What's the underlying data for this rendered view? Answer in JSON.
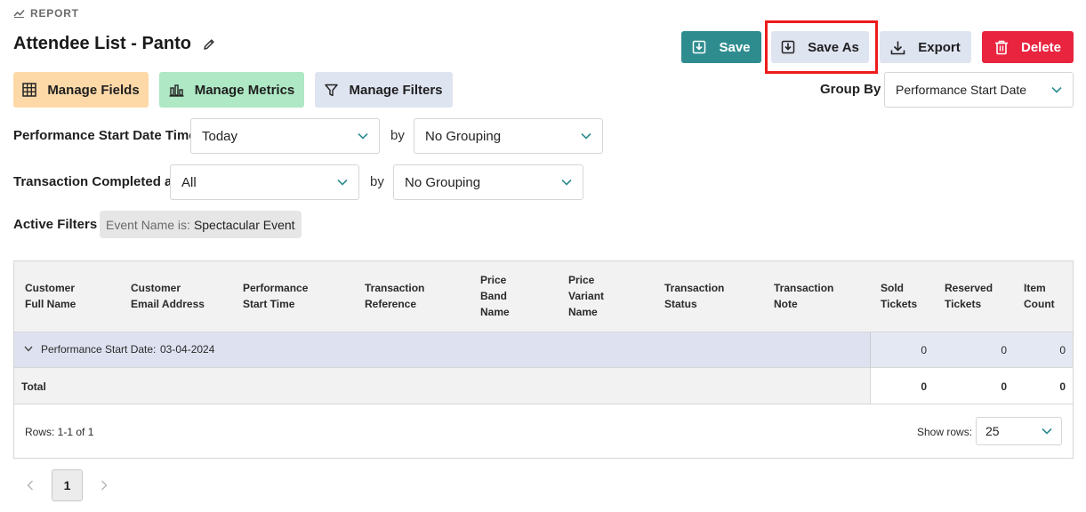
{
  "header": {
    "section_label": "REPORT",
    "title": "Attendee List - Panto",
    "icons": {
      "section": "trend-line-icon",
      "edit": "pencil-icon"
    }
  },
  "actions": {
    "save": "Save",
    "save_as": "Save As",
    "export": "Export",
    "delete": "Delete",
    "colors": {
      "save": "#2e8c8f",
      "neutral": "#dfe4f1",
      "delete": "#e8243f",
      "highlight": "#ee1b1b"
    }
  },
  "managers": {
    "fields": "Manage Fields",
    "metrics": "Manage Metrics",
    "filters": "Manage Filters",
    "colors": {
      "fields": "#fdd9a8",
      "metrics": "#aee8c4",
      "filters": "#dfe4f1"
    }
  },
  "group_by": {
    "label": "Group By",
    "value": "Performance Start Date"
  },
  "date_filters": [
    {
      "label": "Performance Start Date Time",
      "value": "Today",
      "by_label": "by",
      "grouping": "No Grouping"
    },
    {
      "label": "Transaction Completed at",
      "value": "All",
      "by_label": "by",
      "grouping": "No Grouping"
    }
  ],
  "active_filters": {
    "label": "Active Filters",
    "chips": [
      {
        "key": "Event Name is:",
        "value": "Spectacular Event"
      }
    ]
  },
  "table": {
    "columns": [
      [
        "Customer",
        "Full Name"
      ],
      [
        "Customer",
        "Email Address"
      ],
      [
        "Performance",
        "Start Time"
      ],
      [
        "Transaction",
        "Reference"
      ],
      [
        "Price",
        "Band",
        "Name"
      ],
      [
        "Price",
        "Variant",
        "Name"
      ],
      [
        "Transaction",
        "Status"
      ],
      [
        "Transaction",
        "Note"
      ],
      [
        "Sold",
        "Tickets"
      ],
      [
        "Reserved",
        "Tickets"
      ],
      [
        "Item",
        "Count"
      ]
    ],
    "group_row": {
      "label": "Performance Start Date:",
      "value": "03-04-2024",
      "sold": "0",
      "reserved": "0",
      "items": "0"
    },
    "total_row": {
      "label": "Total",
      "sold": "0",
      "reserved": "0",
      "items": "0"
    },
    "rows_info": "Rows: 1-1 of 1",
    "show_rows_label": "Show rows:",
    "show_rows_value": "25"
  },
  "pagination": {
    "current_page": "1"
  }
}
